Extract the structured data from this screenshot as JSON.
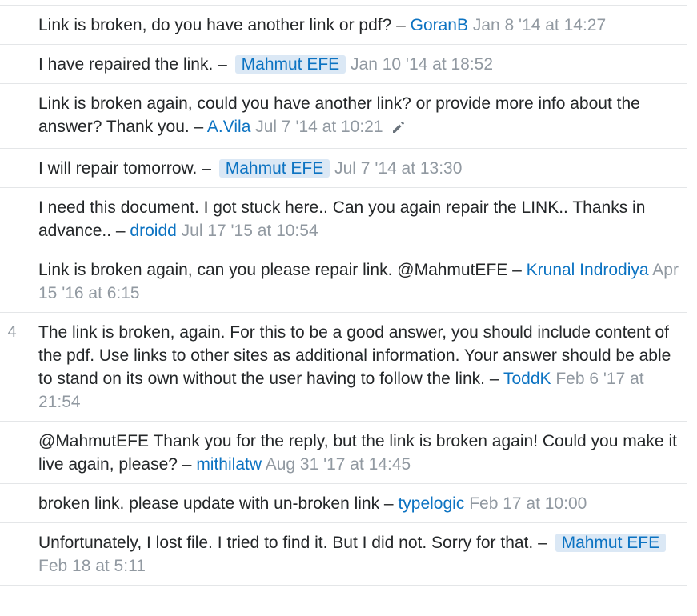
{
  "comments": [
    {
      "score": "",
      "text": "Link is broken, do you have another link or pdf? – ",
      "user": "GoranB",
      "owner": false,
      "date": "Jan 8 '14 at 14:27",
      "edited": false
    },
    {
      "score": "",
      "text": "I have repaired the link. – ",
      "user": "Mahmut EFE",
      "owner": true,
      "date": "Jan 10 '14 at 18:52",
      "edited": false
    },
    {
      "score": "",
      "text": "Link is broken again, could you have another link? or provide more info about the answer? Thank you. – ",
      "user": "A.Vila",
      "owner": false,
      "date": "Jul 7 '14 at 10:21",
      "edited": true
    },
    {
      "score": "",
      "text": "I will repair tomorrow. – ",
      "user": "Mahmut EFE",
      "owner": true,
      "date": "Jul 7 '14 at 13:30",
      "edited": false
    },
    {
      "score": "",
      "text": "I need this document. I got stuck here.. Can you again repair the LINK.. Thanks in advance.. – ",
      "user": "droidd",
      "owner": false,
      "date": "Jul 17 '15 at 10:54",
      "edited": false
    },
    {
      "score": "",
      "text": "Link is broken again, can you please repair link. @MahmutEFE – ",
      "user": "Krunal Indrodiya",
      "owner": false,
      "date": "Apr 15 '16 at 6:15",
      "edited": false
    },
    {
      "score": "4",
      "text": "The link is broken, again. For this to be a good answer, you should include content of the pdf. Use links to other sites as additional information. Your answer should be able to stand on its own without the user having to follow the link. – ",
      "user": "ToddK",
      "owner": false,
      "date": "Feb 6 '17 at 21:54",
      "edited": false
    },
    {
      "score": "",
      "text": "@MahmutEFE Thank you for the reply, but the link is broken again! Could you make it live again, please? – ",
      "user": "mithilatw",
      "owner": false,
      "date": "Aug 31 '17 at 14:45",
      "edited": false
    },
    {
      "score": "",
      "text": "broken link. please update with un-broken link – ",
      "user": "typelogic",
      "owner": false,
      "date": "Feb 17 at 10:00",
      "edited": false
    },
    {
      "score": "",
      "text": "Unfortunately, I lost file. I tried to find it. But I did not. Sorry for that. – ",
      "user": "Mahmut EFE",
      "owner": true,
      "date": "Feb 18 at 5:11",
      "edited": false
    }
  ],
  "icons": {
    "edit": "pencil-icon"
  },
  "colors": {
    "link": "#0c73c2",
    "owner_bg": "#dbe8f5",
    "muted": "#9199a1",
    "divider": "#e4e6e8"
  }
}
